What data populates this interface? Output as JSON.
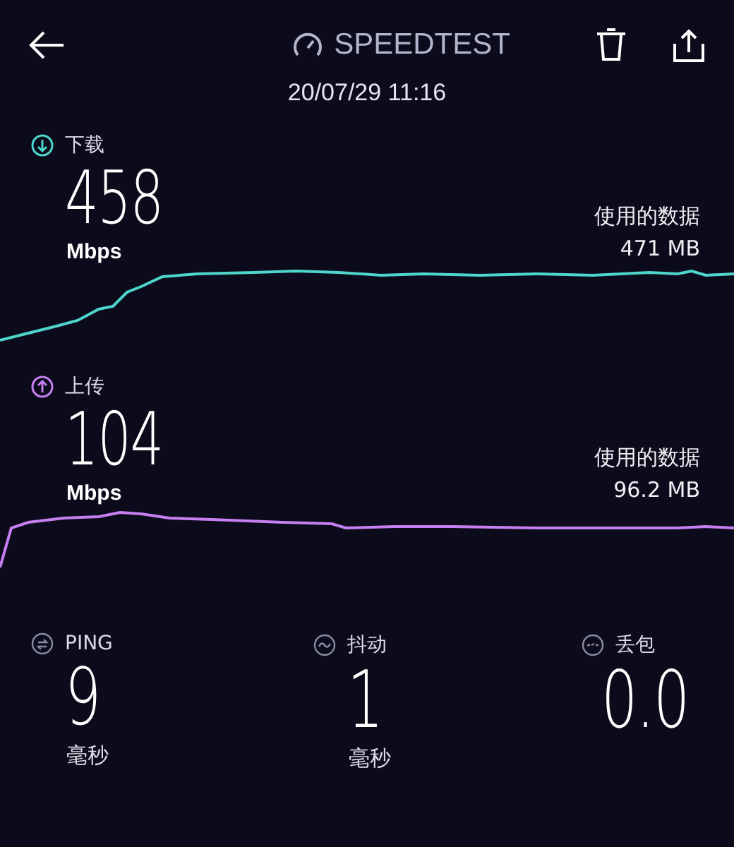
{
  "header": {
    "title": "SPEEDTEST",
    "date": "20/07/29 11:16"
  },
  "tests": [
    {
      "kind": "download",
      "label": "下载",
      "value": "458",
      "unit": "Mbps",
      "data_label": "使用的数据",
      "data_value": "471 MB",
      "color": "#4fd6cc"
    },
    {
      "kind": "upload",
      "label": "上传",
      "value": "104",
      "unit": "Mbps",
      "data_label": "使用的数据",
      "data_value": "96.2 MB",
      "color": "#c67ff0"
    }
  ],
  "stats": [
    {
      "kind": "ping",
      "label": "PING",
      "value": "9",
      "unit": "毫秒"
    },
    {
      "kind": "jitter",
      "label": "抖动",
      "value": "1",
      "unit": "毫秒"
    },
    {
      "kind": "loss",
      "label": "丢包",
      "value": "0.0"
    }
  ]
}
